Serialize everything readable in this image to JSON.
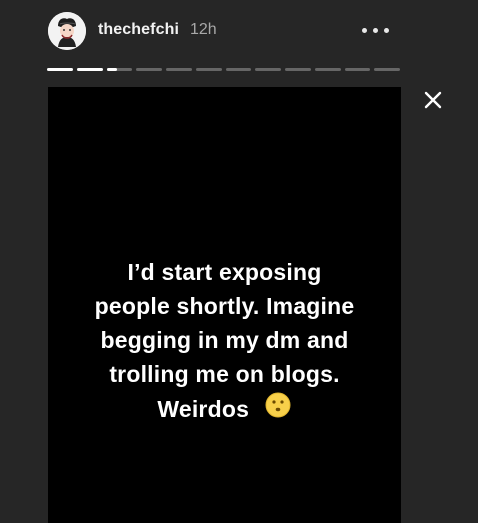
{
  "header": {
    "username": "thechefchi",
    "time": "12h"
  },
  "story": {
    "lines": [
      "I’d start exposing",
      "people shortly. Imagine",
      "begging in my dm and",
      "trolling me on blogs.",
      "Weirdos"
    ],
    "emoji": "hushed-face-emoji",
    "progress": {
      "total_segments": 12,
      "viewed_segments": 2,
      "current_segment": 3,
      "current_segment_progress": 0.4
    }
  },
  "icons": {
    "more": "more-horizontal-icon",
    "close": "close-icon",
    "avatar": "chef-avatar"
  },
  "colors": {
    "background": "#262626",
    "story_background": "#000000",
    "text": "#ffffff",
    "muted": "#a8a8a8",
    "progress_track": "#666666",
    "progress_fill": "#ffffff",
    "emoji": "#f8d04a"
  }
}
